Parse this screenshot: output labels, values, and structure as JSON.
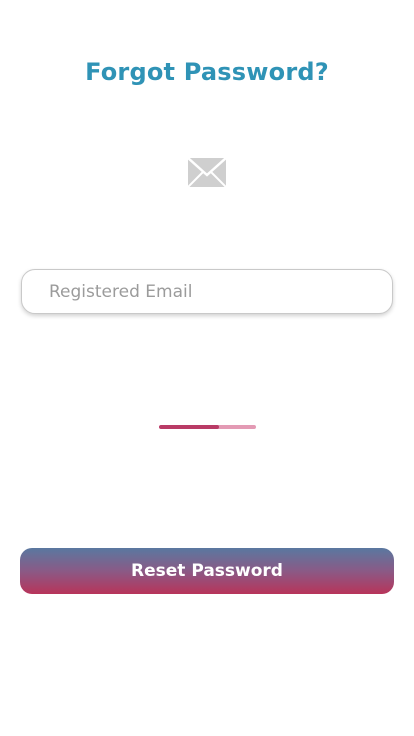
{
  "page": {
    "title": "Forgot Password?"
  },
  "icons": {
    "mail": "envelope-icon"
  },
  "email_field": {
    "placeholder": "Registered Email",
    "value": ""
  },
  "progress": {
    "fraction": 0.62
  },
  "reset_button": {
    "label": "Reset Password"
  },
  "colors": {
    "title": "#2f93b6",
    "accent": "#b93b66",
    "button_gradient_top": "#5a78a0",
    "button_gradient_bottom": "#b8345a"
  }
}
